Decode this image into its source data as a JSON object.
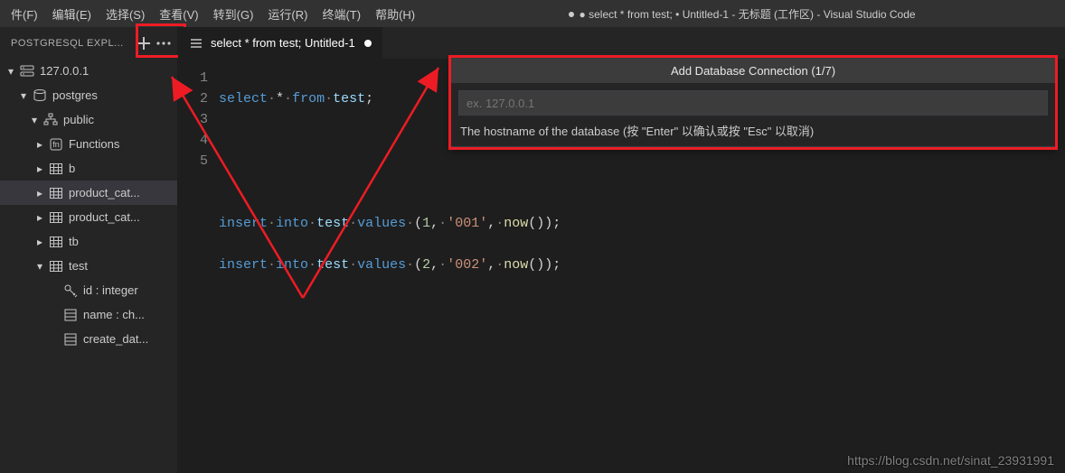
{
  "window": {
    "title": "● select * from test; • Untitled-1 - 无标题 (工作区) - Visual Studio Code"
  },
  "menu": {
    "file": "件(F)",
    "edit": "编辑(E)",
    "select": "选择(S)",
    "view": "查看(V)",
    "goto": "转到(G)",
    "run": "运行(R)",
    "terminal": "终端(T)",
    "help": "帮助(H)"
  },
  "sidebar": {
    "title": "POSTGRESQL EXPL...",
    "items": {
      "server": "127.0.0.1",
      "database": "postgres",
      "schema": "public",
      "functions": "Functions",
      "tbl_b": "b",
      "tbl_pc1": "product_cat...",
      "tbl_pc2": "product_cat...",
      "tbl_tb": "tb",
      "tbl_test": "test",
      "col_id": "id : integer",
      "col_name": "name : ch...",
      "col_cd": "create_dat..."
    }
  },
  "tabs": {
    "title": "select * from test;  Untitled-1"
  },
  "editor": {
    "gutter": [
      "1",
      "2",
      "3",
      "4",
      "5"
    ],
    "line1": {
      "select": "select",
      "star": "*",
      "from": "from",
      "tbl": "test",
      "semi": ";"
    },
    "line4": {
      "insert": "insert",
      "into": "into",
      "tbl": "test",
      "values": "values",
      "l": "(",
      "n": "1",
      "c": ",",
      "s": "'001'",
      "c2": ",",
      "fn": "now",
      "lp": "(",
      "rp": ")",
      "rpar": ")",
      "semi": ";"
    },
    "line5": {
      "insert": "insert",
      "into": "into",
      "tbl": "test",
      "values": "values",
      "l": "(",
      "n": "2",
      "c": ",",
      "s": "'002'",
      "c2": ",",
      "fn": "now",
      "lp": "(",
      "rp": ")",
      "rpar": ")",
      "semi": ";"
    }
  },
  "quickinput": {
    "title": "Add Database Connection (1/7)",
    "placeholder": "ex. 127.0.0.1",
    "hint": "The hostname of the database (按 \"Enter\" 以确认或按 \"Esc\" 以取消)"
  },
  "watermark": "https://blog.csdn.net/sinat_23931991"
}
